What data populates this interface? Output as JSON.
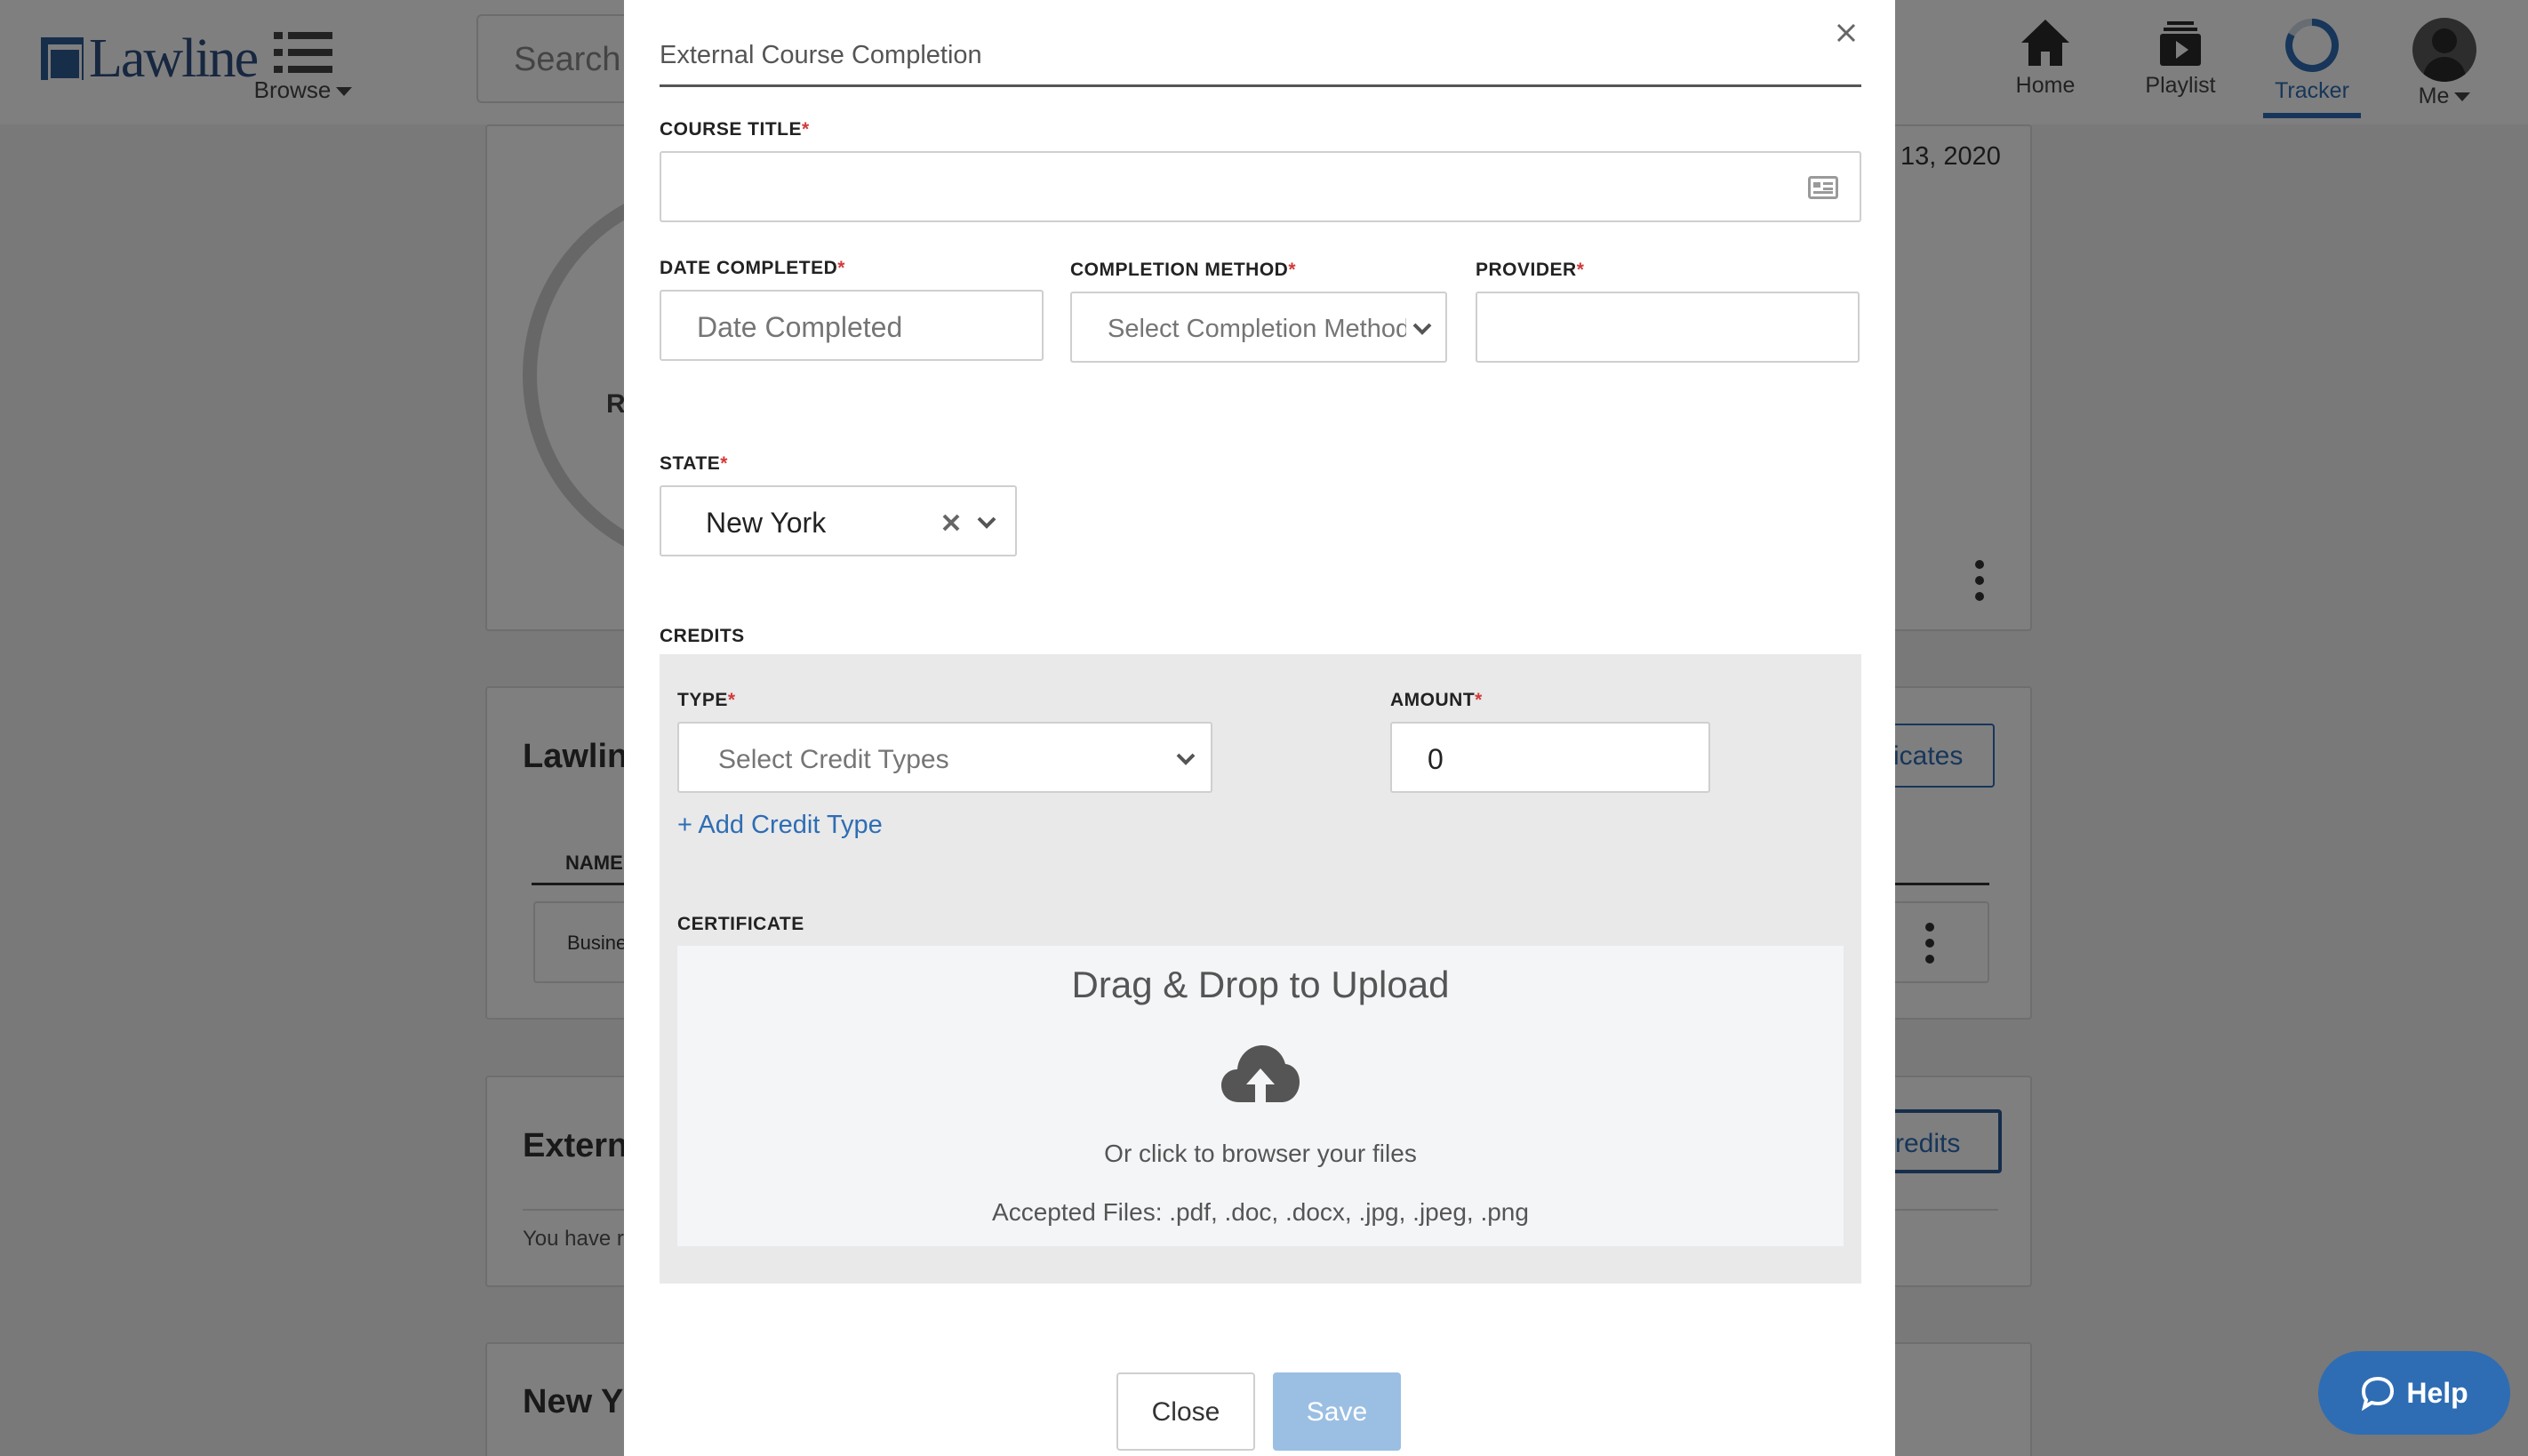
{
  "header": {
    "logo_text": "Lawline",
    "browse_label": "Browse",
    "search_placeholder_fragment": "Search f",
    "nav": {
      "home": "Home",
      "playlist": "Playlist",
      "tracker": "Tracker",
      "me": "Me"
    }
  },
  "background": {
    "date_fragment": "13, 2020",
    "ring_letter": "R",
    "card2_heading": "Lawlin",
    "card2_button_fragment": "icates",
    "table_header_name": "NAME",
    "row_fragment": "Busine",
    "card3_heading": "Extern",
    "card3_button_fragment": "redits",
    "card3_text": "You have r",
    "card4_heading": "New Y"
  },
  "modal": {
    "title": "External Course Completion",
    "course_title_label": "COURSE TITLE",
    "date_completed_label": "DATE COMPLETED",
    "date_completed_placeholder": "Date Completed",
    "completion_method_label": "COMPLETION METHOD",
    "completion_method_placeholder": "Select Completion Method",
    "provider_label": "PROVIDER",
    "state_label": "STATE",
    "state_value": "New York",
    "credits_label": "CREDITS",
    "type_label": "TYPE",
    "type_placeholder": "Select Credit Types",
    "amount_label": "AMOUNT",
    "amount_value": "0",
    "add_credit_type": "+ Add Credit Type",
    "certificate_label": "CERTIFICATE",
    "dropzone_title": "Drag & Drop to Upload",
    "dropzone_sub": "Or click to browser your files",
    "dropzone_accepted": "Accepted Files: .pdf, .doc, .docx, .jpg, .jpeg, .png",
    "required_marker": "*",
    "close_button": "Close",
    "save_button": "Save"
  },
  "help_button": "Help",
  "colors": {
    "accent": "#2e6db4",
    "save_disabled": "#9bbfe3",
    "required": "#d23a3a",
    "credits_bg": "#e9e9e9"
  }
}
